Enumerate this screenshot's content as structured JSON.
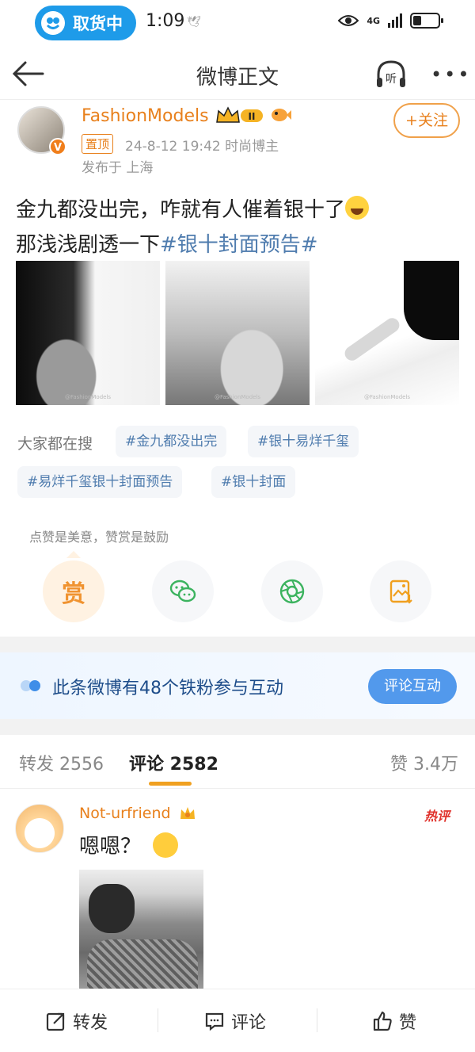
{
  "status_bar": {
    "app_pill_label": "取货中",
    "time": "1:09",
    "network": "4G"
  },
  "header": {
    "title": "微博正文",
    "listen_label": "听"
  },
  "post": {
    "author": {
      "name": "FashionModels",
      "level_badge": "II",
      "verified_mark": "V"
    },
    "follow_button": "+关注",
    "pinned_tag": "置顶",
    "timestamp": "24-8-12 19:42",
    "author_category": "时尚博主",
    "location": "发布于 上海",
    "text_line1": "金九都没出完，咋就有人催着银十了",
    "text_line2": "那浅浅剧透一下",
    "hashtag": "#银十封面预告#",
    "photo_watermark": "@FashionModels"
  },
  "search": {
    "label": "大家都在搜",
    "chips": [
      "#金九都没出完",
      "#银十易烊千玺",
      "#易烊千玺银十封面预告",
      "#银十封面"
    ]
  },
  "tip": {
    "hint": "点赞是美意，赞赏是鼓励",
    "reward_label": "赏"
  },
  "fans_banner": {
    "text": "此条微博有48个铁粉参与互动",
    "button": "评论互动"
  },
  "tabs": {
    "repost": "转发 2556",
    "comments": "评论 2582",
    "likes": "赞 3.4万"
  },
  "comment": {
    "user": "Not-urfriend",
    "hot_tag": "热评",
    "text": "嗯嗯？"
  },
  "bottom_bar": {
    "repost": "转发",
    "comment": "评论",
    "like": "赞"
  },
  "colors": {
    "accent_orange": "#e8801c",
    "link_blue": "#4f7cae",
    "pill_blue": "#1e9be9"
  }
}
